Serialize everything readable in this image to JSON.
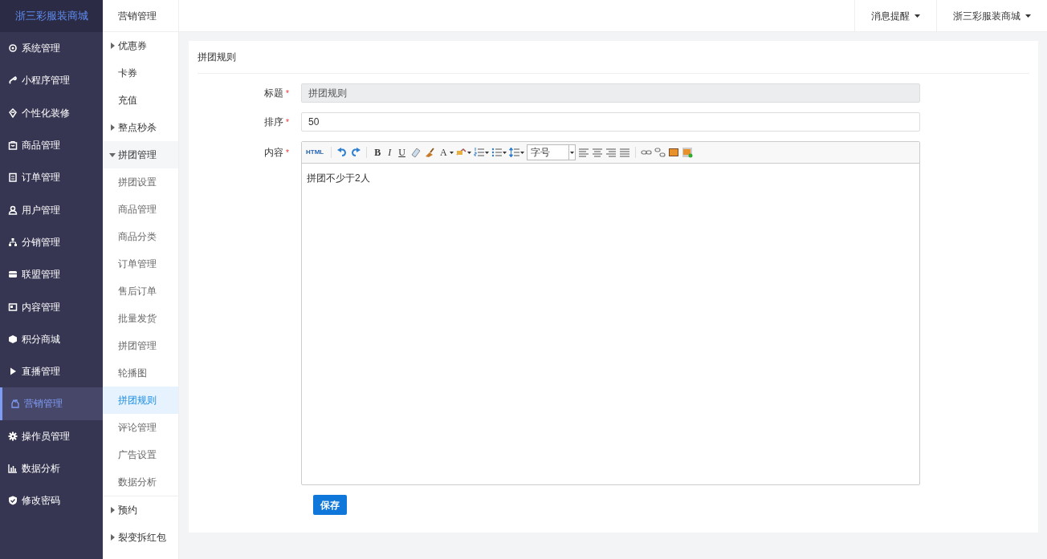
{
  "brand": "浙三彩服装商城",
  "sidebar": {
    "items": [
      {
        "label": "系统管理",
        "selected": false
      },
      {
        "label": "小程序管理",
        "selected": false
      },
      {
        "label": "个性化装修",
        "selected": false
      },
      {
        "label": "商品管理",
        "selected": false
      },
      {
        "label": "订单管理",
        "selected": false
      },
      {
        "label": "用户管理",
        "selected": false
      },
      {
        "label": "分销管理",
        "selected": false
      },
      {
        "label": "联盟管理",
        "selected": false
      },
      {
        "label": "内容管理",
        "selected": false
      },
      {
        "label": "积分商城",
        "selected": false
      },
      {
        "label": "直播管理",
        "selected": false
      },
      {
        "label": "营销管理",
        "selected": true
      },
      {
        "label": "操作员管理",
        "selected": false
      },
      {
        "label": "数据分析",
        "selected": false
      },
      {
        "label": "修改密码",
        "selected": false
      }
    ]
  },
  "submenu": {
    "title": "营销管理",
    "items": [
      {
        "kind": "group",
        "label": "优惠券",
        "expanded": false
      },
      {
        "kind": "link",
        "label": "卡券",
        "selected": false
      },
      {
        "kind": "link",
        "label": "充值",
        "selected": false
      },
      {
        "kind": "group",
        "label": "整点秒杀",
        "expanded": false
      },
      {
        "kind": "group",
        "label": "拼团管理",
        "expanded": true,
        "children": [
          {
            "label": "拼团设置",
            "selected": false
          },
          {
            "label": "商品管理",
            "selected": false
          },
          {
            "label": "商品分类",
            "selected": false
          },
          {
            "label": "订单管理",
            "selected": false
          },
          {
            "label": "售后订单",
            "selected": false
          },
          {
            "label": "批量发货",
            "selected": false
          },
          {
            "label": "拼团管理",
            "selected": false
          },
          {
            "label": "轮播图",
            "selected": false
          },
          {
            "label": "拼团规则",
            "selected": true
          },
          {
            "label": "评论管理",
            "selected": false
          },
          {
            "label": "广告设置",
            "selected": false
          },
          {
            "label": "数据分析",
            "selected": false
          }
        ]
      },
      {
        "kind": "group",
        "label": "预约",
        "expanded": false
      },
      {
        "kind": "group",
        "label": "裂变拆红包",
        "expanded": false
      }
    ]
  },
  "header": {
    "menus": [
      "消息提醒",
      "浙三彩服装商城"
    ]
  },
  "card": {
    "title": "拼团规则"
  },
  "form": {
    "fields": [
      {
        "kind": "input",
        "label": "标题",
        "required_mark": "*",
        "value": "拼团规则",
        "disabled": true
      },
      {
        "kind": "input",
        "label": "排序",
        "required_mark": "*",
        "value": "50",
        "disabled": false
      },
      {
        "kind": "editor",
        "label": "内容",
        "required_mark": "*",
        "value": "拼团不少于2人"
      }
    ],
    "toolbar": {
      "html_label": "HTML",
      "bold": "B",
      "italic": "I",
      "underline": "U",
      "font_color": "A",
      "font_size": "字号"
    },
    "save_button": "保存"
  }
}
